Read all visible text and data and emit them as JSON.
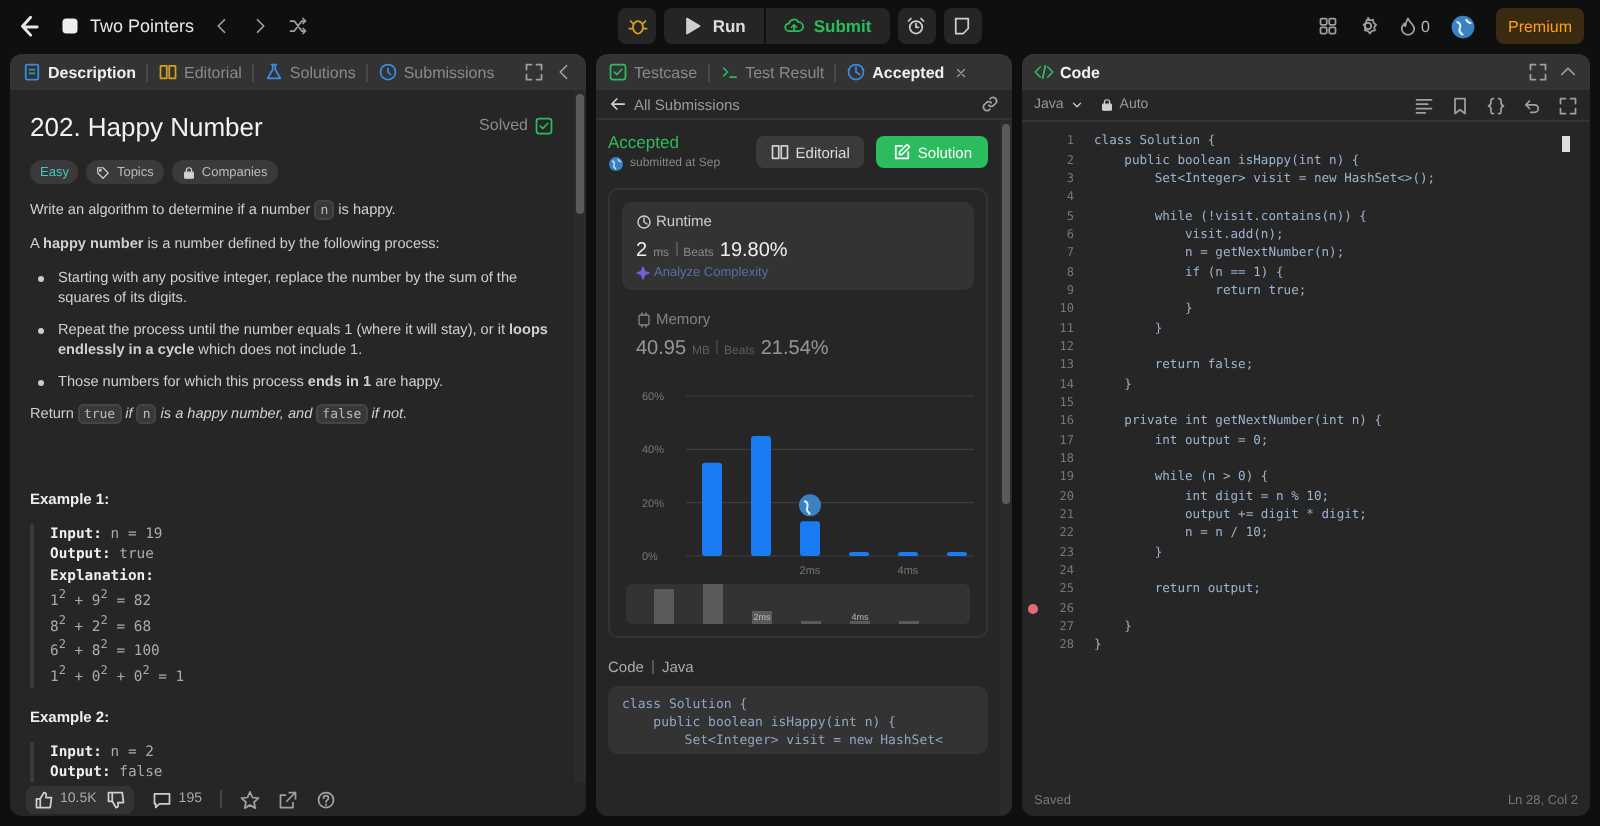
{
  "top_bar": {
    "problem_list": "Two Pointers",
    "run": "Run",
    "submit": "Submit",
    "streak": "0",
    "premium": "Premium"
  },
  "description_panel": {
    "tabs": [
      {
        "label": "Description",
        "selected": true,
        "kind": "description"
      },
      {
        "label": "Editorial",
        "selected": false,
        "kind": "editorial"
      },
      {
        "label": "Solutions",
        "selected": false,
        "kind": "solutions"
      },
      {
        "label": "Submissions",
        "selected": false,
        "kind": "submissions"
      }
    ],
    "title": "202. Happy Number",
    "status": "Solved",
    "tags": [
      {
        "label": "Easy",
        "kind": "difficulty"
      },
      {
        "label": "Topics",
        "kind": "topics"
      },
      {
        "label": "Companies",
        "kind": "companies"
      }
    ],
    "blocks": [
      {
        "kind": "para",
        "segments": [
          {
            "kind": "text",
            "text": "Write an algorithm to determine if a number "
          },
          {
            "kind": "code",
            "text": "n"
          },
          {
            "kind": "text",
            "text": " is happy."
          }
        ]
      },
      {
        "kind": "para",
        "segments": [
          {
            "kind": "text",
            "text": "A **happy number** is a number defined by the following process:"
          }
        ]
      },
      {
        "kind": "bullets",
        "items": [
          [
            {
              "kind": "text",
              "text": "Starting with any positive integer, replace the number by the sum of the squares of its digits."
            }
          ],
          [
            {
              "kind": "text",
              "text": "Repeat the process until the number equals 1 (where it will stay), or it **loops endlessly in a cycle** which does not include 1."
            }
          ],
          [
            {
              "kind": "text",
              "text": "Those numbers for which this process **ends in 1** are happy."
            }
          ]
        ]
      },
      {
        "kind": "para",
        "segments": [
          {
            "kind": "text",
            "text": "Return "
          },
          {
            "kind": "code",
            "text": "true"
          },
          {
            "kind": "text",
            "text": " *if* "
          },
          {
            "kind": "code",
            "text": "n"
          },
          {
            "kind": "text",
            "text": " *is a happy number, and* "
          },
          {
            "kind": "code",
            "text": "false"
          },
          {
            "kind": "text",
            "text": " *if not.*"
          }
        ]
      },
      {
        "kind": "heading",
        "text": "Example 1:"
      },
      {
        "kind": "example",
        "lines": [
          "**Input:** n = 19",
          "**Output:** true",
          "**Explanation:**",
          "1$^{2}$ + 9$^{2}$ = 82",
          "8$^{2}$ + 2$^{2}$ = 68",
          "6$^{2}$ + 8$^{2}$ = 100",
          "1$^{2}$ + 0$^{2}$ + 0$^{2}$ = 1"
        ]
      },
      {
        "kind": "heading",
        "text": "Example 2:"
      },
      {
        "kind": "example",
        "lines": [
          "**Input:** n = 2",
          "**Output:** false"
        ]
      }
    ],
    "footer": {
      "likes": "10.5K",
      "comments": "195"
    }
  },
  "result_panel": {
    "tabs": [
      {
        "label": "Testcase",
        "selected": false,
        "kind": "testcase"
      },
      {
        "label": "Test Result",
        "selected": false,
        "kind": "result"
      },
      {
        "label": "Accepted",
        "selected": true,
        "kind": "accepted"
      }
    ],
    "back": "All Submissions",
    "status": "Accepted",
    "submitted": "submitted at Sep",
    "editorial": "Editorial",
    "solution": "Solution",
    "stats": [
      {
        "kind": "runtime",
        "label": "Runtime",
        "value": "2",
        "unit": "ms",
        "beats_label": "Beats",
        "beats": "19.80%",
        "link": "Analyze Complexity",
        "selected": true
      },
      {
        "kind": "memory",
        "label": "Memory",
        "value": "40.95",
        "unit": "MB",
        "beats_label": "Beats",
        "beats": "21.54%",
        "selected": false
      }
    ],
    "chart_data": {
      "type": "bar",
      "categories": [
        null,
        null,
        "2ms",
        null,
        "4ms",
        null
      ],
      "values": [
        35,
        45,
        13,
        1.5,
        1.5,
        1.5
      ],
      "ylim": [
        0,
        60
      ],
      "yticks": [
        {
          "value": 0,
          "label": "0%"
        },
        {
          "value": 20,
          "label": "20%"
        },
        {
          "value": 40,
          "label": "40%"
        },
        {
          "value": 60,
          "label": "60%"
        }
      ],
      "annotations": [
        {
          "x": "2ms"
        }
      ]
    },
    "overview_labels": [
      "2ms",
      "4ms"
    ],
    "code_label": "Code",
    "code_lang": "Java",
    "code_lines": [
      "class Solution {",
      "    public boolean isHappy(int n) {",
      "        Set<Integer> visit = new HashSet<"
    ]
  },
  "code_panel": {
    "title": "Code",
    "language": "Java",
    "mode": "Auto",
    "lines": [
      {
        "number": "1",
        "text": "class Solution {",
        "breakpoint": false
      },
      {
        "number": "2",
        "text": "    public boolean isHappy(int n) {",
        "breakpoint": false
      },
      {
        "number": "3",
        "text": "        Set<Integer> visit = new HashSet<>();",
        "breakpoint": false
      },
      {
        "number": "4",
        "breakpoint": false
      },
      {
        "number": "5",
        "text": "        while (!visit.contains(n)) {",
        "breakpoint": false
      },
      {
        "number": "6",
        "text": "            visit.add(n);",
        "breakpoint": false
      },
      {
        "number": "7",
        "text": "            n = getNextNumber(n);",
        "breakpoint": false
      },
      {
        "number": "8",
        "text": "            if (n == 1) {",
        "breakpoint": false
      },
      {
        "number": "9",
        "text": "                return true;",
        "breakpoint": false
      },
      {
        "number": "10",
        "text": "            }",
        "breakpoint": false
      },
      {
        "number": "11",
        "text": "        }",
        "breakpoint": false
      },
      {
        "number": "12",
        "breakpoint": false
      },
      {
        "number": "13",
        "text": "        return false;",
        "breakpoint": false
      },
      {
        "number": "14",
        "text": "    }",
        "breakpoint": false
      },
      {
        "number": "15",
        "breakpoint": false
      },
      {
        "number": "16",
        "text": "    private int getNextNumber(int n) {",
        "breakpoint": false
      },
      {
        "number": "17",
        "text": "        int output = 0;",
        "breakpoint": false
      },
      {
        "number": "18",
        "breakpoint": false
      },
      {
        "number": "19",
        "text": "        while (n > 0) {",
        "breakpoint": false
      },
      {
        "number": "20",
        "text": "            int digit = n % 10;",
        "breakpoint": false
      },
      {
        "number": "21",
        "text": "            output += digit * digit;",
        "breakpoint": false
      },
      {
        "number": "22",
        "text": "            n = n / 10;",
        "breakpoint": false
      },
      {
        "number": "23",
        "text": "        }",
        "breakpoint": false
      },
      {
        "number": "24",
        "breakpoint": false
      },
      {
        "number": "25",
        "text": "        return output;",
        "breakpoint": false
      },
      {
        "number": "26",
        "breakpoint": true
      },
      {
        "number": "27",
        "text": "    }",
        "breakpoint": false
      },
      {
        "number": "28",
        "text": "}",
        "breakpoint": false
      }
    ],
    "status": "Saved",
    "cursor": "Ln 28, Col 2"
  }
}
